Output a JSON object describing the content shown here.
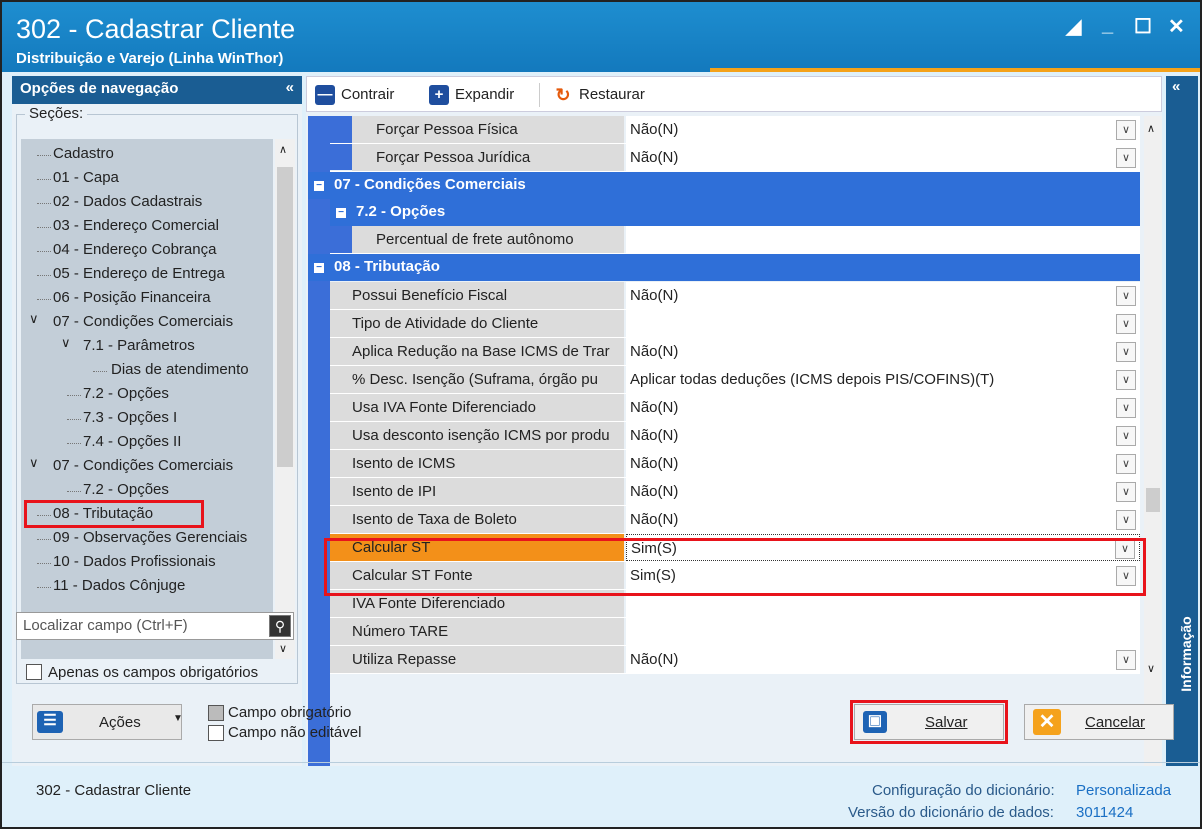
{
  "window": {
    "title": "302 - Cadastrar Cliente",
    "subtitle": "Distribuição e Varejo (Linha WinThor)"
  },
  "nav": {
    "header": "Opções de navegação",
    "collapse": "«",
    "sections_label": "Seções:",
    "items": [
      "Cadastro",
      "01 - Capa",
      "02 - Dados Cadastrais",
      "03 - Endereço Comercial",
      "04 - Endereço Cobrança",
      "05 - Endereço de Entrega",
      "06 - Posição Financeira",
      "07 - Condições Comerciais",
      "7.1 - Parâmetros",
      "Dias de atendimento",
      "7.2 - Opções",
      "7.3 - Opções I",
      "7.4 - Opções II",
      "07 - Condições Comerciais",
      "7.2 - Opções",
      "08 - Tributação",
      "09 - Observações Gerenciais",
      "10 - Dados Profissionais",
      "11 - Dados Cônjuge"
    ],
    "search_placeholder": "Localizar campo (Ctrl+F)",
    "only_required_label": "Apenas os campos obrigatórios"
  },
  "toolbar": {
    "collapse": "Contrair",
    "expand": "Expandir",
    "restore": "Restaurar"
  },
  "grid": {
    "rows_top": [
      {
        "label": "Forçar Pessoa Física",
        "value": "Não(N)"
      },
      {
        "label": "Forçar Pessoa Jurídica",
        "value": "Não(N)"
      }
    ],
    "section_07": "07 - Condições Comerciais",
    "section_72": "7.2 - Opções",
    "row_frete": {
      "label": "Percentual de frete autônomo",
      "value": ""
    },
    "section_08": "08 - Tributação",
    "rows_trib": [
      {
        "label": "Possui Benefício Fiscal",
        "value": "Não(N)"
      },
      {
        "label": "Tipo de Atividade do Cliente",
        "value": ""
      },
      {
        "label": "Aplica Redução na Base ICMS de Trar",
        "value": "Não(N)"
      },
      {
        "label": "% Desc. Isenção (Suframa, órgão pu",
        "value": "Aplicar todas deduções (ICMS depois PIS/COFINS)(T)"
      },
      {
        "label": "Usa IVA Fonte Diferenciado",
        "value": "Não(N)"
      },
      {
        "label": "Usa desconto isenção ICMS por produ",
        "value": "Não(N)"
      },
      {
        "label": "Isento de ICMS",
        "value": "Não(N)"
      },
      {
        "label": "Isento de IPI",
        "value": "Não(N)"
      },
      {
        "label": "Isento de Taxa de Boleto",
        "value": "Não(N)"
      },
      {
        "label": "Calcular ST",
        "value": "Sim(S)"
      },
      {
        "label": "Calcular ST Fonte",
        "value": "Sim(S)"
      },
      {
        "label": "IVA Fonte Diferenciado",
        "value": ""
      },
      {
        "label": "Número TARE",
        "value": ""
      },
      {
        "label": "Utiliza Repasse",
        "value": "Não(N)"
      }
    ]
  },
  "info_panel": {
    "label": "Informação",
    "collapse": "«"
  },
  "bottom": {
    "actions": "Ações",
    "legend_required": "Campo obrigatório",
    "legend_not_editable": "Campo não editável",
    "save": "Salvar",
    "cancel": "Cancelar"
  },
  "status": {
    "left": "302 - Cadastrar Cliente",
    "dict_config_label": "Configuração do dicionário:",
    "dict_config_value": "Personalizada",
    "dict_version_label": "Versão do dicionário de dados:",
    "dict_version_value": "3011424"
  },
  "colors": {
    "title_bar": "#1379bd",
    "section": "#2f6fd8",
    "highlight": "#f39019",
    "red_box": "#e8131b"
  }
}
